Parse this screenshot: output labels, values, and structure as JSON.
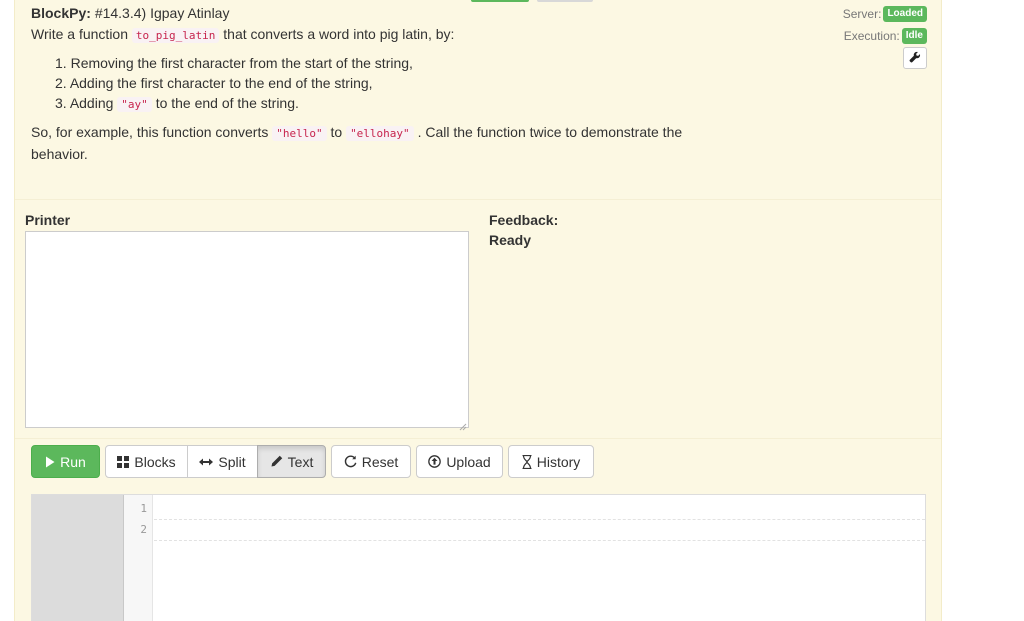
{
  "assignment": {
    "app_name": "BlockPy:",
    "problem_id": "#14.3.4) Igpay Atinlay",
    "intro_before": "Write a function",
    "function_name": "to_pig_latin",
    "intro_after": "that converts a word into pig latin, by:",
    "steps": [
      {
        "num": "1.",
        "text": "Removing the first character from the start of the string,"
      },
      {
        "num": "2.",
        "text": "Adding the first character to the end of the string,"
      },
      {
        "num": "3.",
        "text_before": "Adding",
        "code": "\"ay\"",
        "text_after": "to the end of the string."
      }
    ],
    "example_before": "So, for example, this function converts",
    "example_input": "\"hello\"",
    "example_to": "to",
    "example_output": "\"ellohay\"",
    "example_after": ". Call the function twice to demonstrate the behavior."
  },
  "status": {
    "server_label": "Server:",
    "server_value": "Loaded",
    "execution_label": "Execution:",
    "execution_value": "Idle",
    "badge_color": "#5cb85c"
  },
  "console": {
    "printer_label": "Printer",
    "feedback_label": "Feedback:",
    "feedback_message": "Ready"
  },
  "toolbar": {
    "run": "Run",
    "blocks": "Blocks",
    "split": "Split",
    "text": "Text",
    "reset": "Reset",
    "upload": "Upload",
    "history": "History",
    "active_mode": "Text"
  },
  "editor": {
    "line_numbers": [
      "1",
      "2"
    ]
  },
  "colors": {
    "panel_background": "#fcf8e3",
    "run_button": "#5cb85c",
    "code_text": "#c7254e"
  }
}
